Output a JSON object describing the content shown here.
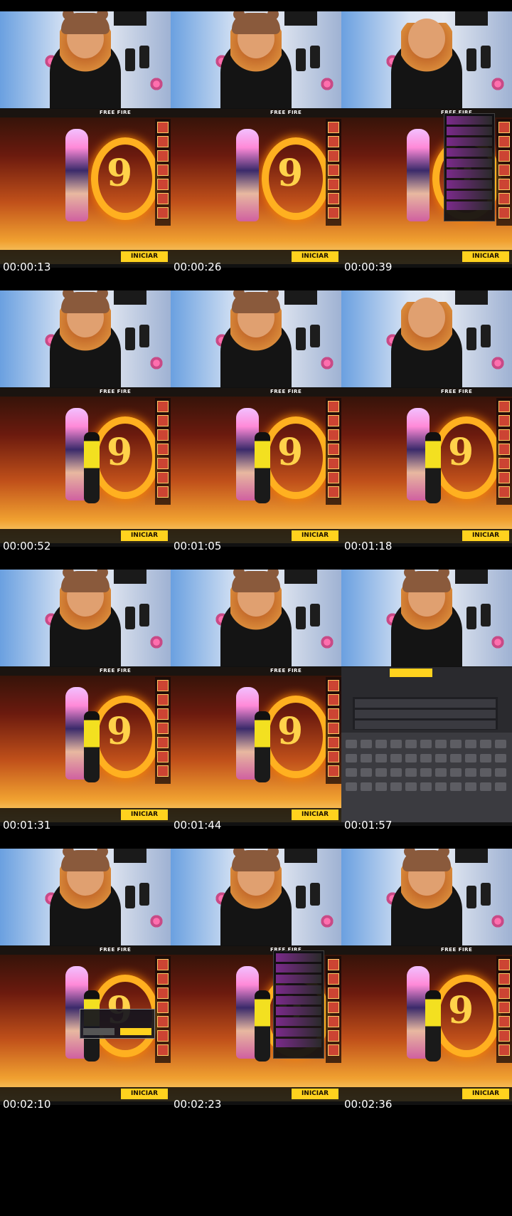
{
  "game": {
    "logo": "FREE FIRE",
    "start_button": "INICIAR"
  },
  "thumbnails": [
    {
      "timestamp": "00:00:13",
      "scene": "lobby"
    },
    {
      "timestamp": "00:00:26",
      "scene": "lobby"
    },
    {
      "timestamp": "00:00:39",
      "scene": "panel"
    },
    {
      "timestamp": "00:00:52",
      "scene": "duo"
    },
    {
      "timestamp": "00:01:05",
      "scene": "duo"
    },
    {
      "timestamp": "00:01:18",
      "scene": "duo"
    },
    {
      "timestamp": "00:01:31",
      "scene": "duo"
    },
    {
      "timestamp": "00:01:44",
      "scene": "duo"
    },
    {
      "timestamp": "00:01:57",
      "scene": "friends"
    },
    {
      "timestamp": "00:02:10",
      "scene": "dialog"
    },
    {
      "timestamp": "00:02:23",
      "scene": "panel-duo"
    },
    {
      "timestamp": "00:02:36",
      "scene": "trio"
    }
  ]
}
